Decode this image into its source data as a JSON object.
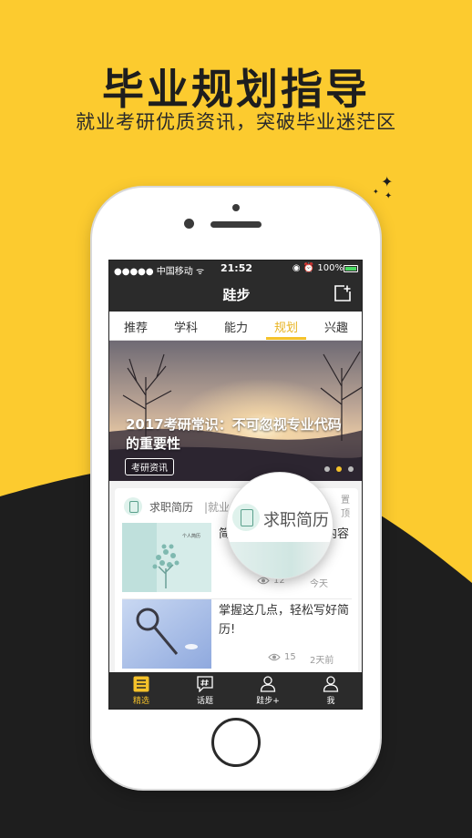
{
  "promo": {
    "title": "毕业规划指导",
    "subtitle": "就业考研优质资讯，突破毕业迷茫区"
  },
  "status_bar": {
    "carrier": "●●●●● 中国移动 ᯤ",
    "time": "21:52",
    "battery": "◉ ⏰ 100%"
  },
  "nav": {
    "title": "跬步"
  },
  "tabs": [
    {
      "label": "推荐"
    },
    {
      "label": "学科"
    },
    {
      "label": "能力"
    },
    {
      "label": "规划"
    },
    {
      "label": "兴趣"
    }
  ],
  "active_tab": "规划",
  "banner": {
    "title": "2017考研常识：不可忽视专业代码的重要性",
    "tag": "考研资讯",
    "slides": 3,
    "active_slide": 2
  },
  "card": {
    "category": "求职简历",
    "category_extra": "|就业",
    "pinned_label": "置顶",
    "articles": [
      {
        "title": "简历中应该包含哪些内容",
        "views": "12",
        "date": "今天",
        "thumb_text": "个人简历"
      },
      {
        "title": "掌握这几点，轻松写好简历!",
        "views": "15",
        "date": "2天前"
      }
    ]
  },
  "magnifier": {
    "label": "求职简历"
  },
  "bottom_tabs": [
    {
      "label": "精选",
      "icon": "list-icon"
    },
    {
      "label": "话题",
      "icon": "hash-chat-icon"
    },
    {
      "label": "跬步+",
      "icon": "person-plus-icon"
    },
    {
      "label": "我",
      "icon": "person-icon"
    }
  ],
  "colors": {
    "background": "#FCCB2F",
    "dark": "#1E1E1E",
    "accent": "#F5C22A",
    "bar": "#2B2B2B"
  }
}
